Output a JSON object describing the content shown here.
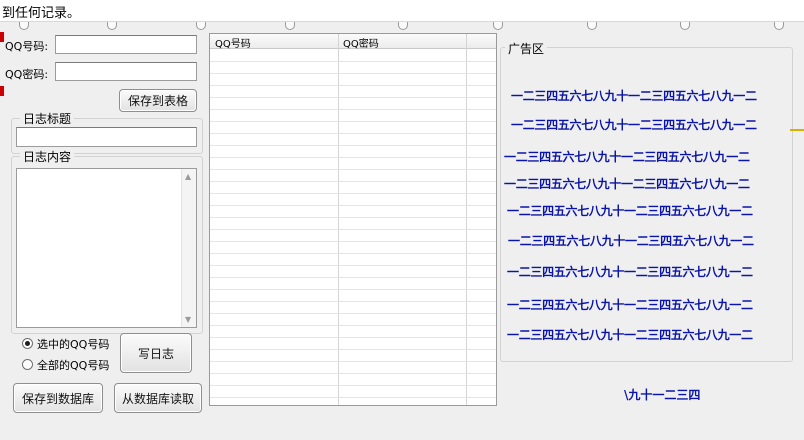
{
  "window": {
    "top_message": "到任何记录。"
  },
  "form": {
    "qq_number_label": "QQ号码:",
    "qq_number_value": "",
    "qq_password_label": "QQ密码:",
    "qq_password_value": "",
    "save_to_table_label": "保存到表格"
  },
  "log": {
    "title_group_label": "日志标题",
    "title_value": "",
    "content_group_label": "日志内容",
    "content_value": "",
    "scroll_up_glyph": "▲",
    "scroll_down_glyph": "▼"
  },
  "target": {
    "selected_label": "选中的QQ号码",
    "all_label": "全部的QQ号码",
    "selected": "selected"
  },
  "actions": {
    "write_log_label": "写日志",
    "save_to_db_label": "保存到数据库",
    "read_from_db_label": "从数据库读取"
  },
  "grid": {
    "columns": [
      "QQ号码",
      "QQ密码"
    ],
    "rows": []
  },
  "ads": {
    "group_label": "广告区",
    "lines": [
      "一二三四五六七八九十一二三四五六七八九一二",
      "一二三四五六七八九十一二三四五六七八九一二",
      "一二三四五六七八九十一二三四五六七八九一二",
      "一二三四五六七八九十一二三四五六七八九一二",
      "一二三四五六七八九十一二三四五六七八九一二",
      "一二三四五六七八九十一二三四五六七八九一二",
      "一二三四五六七八九十一二三四五六七八九一二",
      "一二三四五六七八九十一二三四五六七八九一二",
      "一二三四五六七八九十一二三四五六七八九一二"
    ],
    "scroll_text": "\\九十一二三四"
  },
  "colors": {
    "ad_text": "#0a14a8",
    "accent_red": "#cc0000"
  }
}
